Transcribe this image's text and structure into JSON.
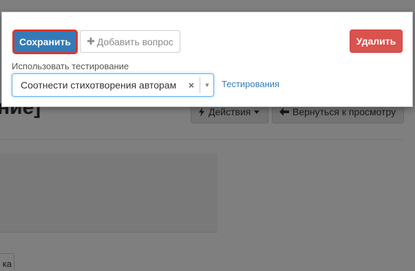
{
  "background": {
    "title_fragment": "ние]",
    "actions_label": "Действия",
    "back_label": "Вернуться к просмотру",
    "mini_button_label": "ка"
  },
  "modal": {
    "save_label": "Сохранить",
    "add_question_label": "Добавить вопрос",
    "delete_label": "Удалить",
    "use_testing_label": "Использовать тестирование",
    "select": {
      "selected_value": "Соотнести стихотворения авторам",
      "clear_glyph": "×",
      "arrow_glyph": "▼"
    },
    "testing_link_label": "Тестирования"
  },
  "colors": {
    "primary": "#337ab7",
    "danger": "#d9534f",
    "focus_outline": "#d9372f"
  },
  "icons": {
    "add": "plus-icon",
    "actions": "bolt-icon",
    "actions_caret": "caret-down-icon",
    "back": "arrow-left-icon",
    "clear": "clear-icon",
    "dropdown": "chevron-down-icon"
  }
}
